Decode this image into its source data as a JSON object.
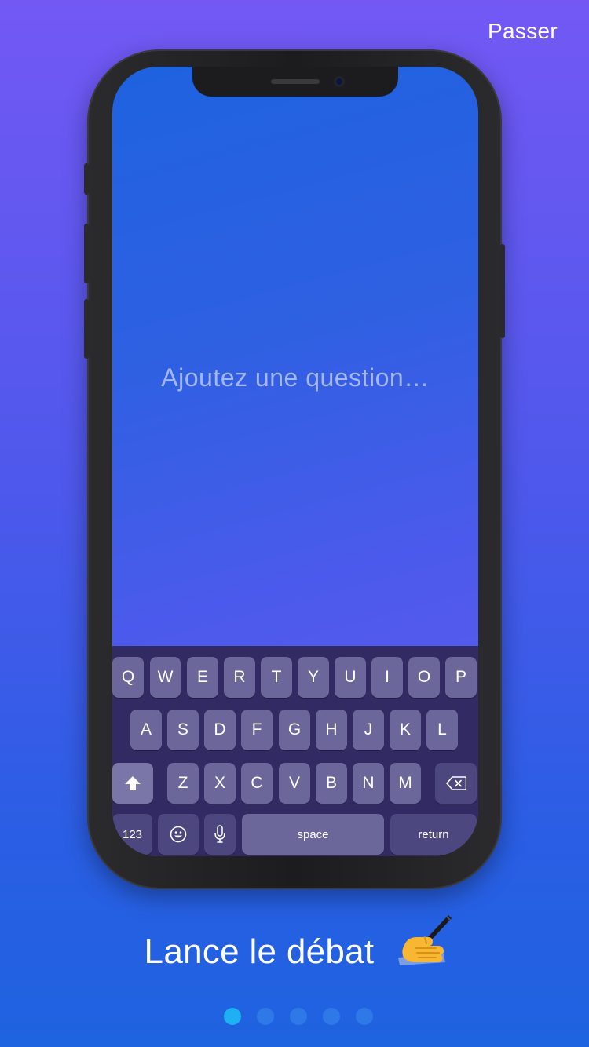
{
  "header": {
    "skip_label": "Passer"
  },
  "screen": {
    "question_placeholder": "Ajoutez une question…"
  },
  "keyboard": {
    "row1": [
      "Q",
      "W",
      "E",
      "R",
      "T",
      "Y",
      "U",
      "I",
      "O",
      "P"
    ],
    "row2": [
      "A",
      "S",
      "D",
      "F",
      "G",
      "H",
      "J",
      "K",
      "L"
    ],
    "row3": [
      "Z",
      "X",
      "C",
      "V",
      "B",
      "N",
      "M"
    ],
    "numbers_label": "123",
    "space_label": "space",
    "return_label": "return"
  },
  "onboarding": {
    "title": "Lance le débat",
    "page_count": 5,
    "active_page": 1
  },
  "colors": {
    "active_dot": "#1fb0f4",
    "inactive_dot": "#2f78e8",
    "keyboard_bg": "#312a63",
    "key_bg": "#6c679a"
  }
}
